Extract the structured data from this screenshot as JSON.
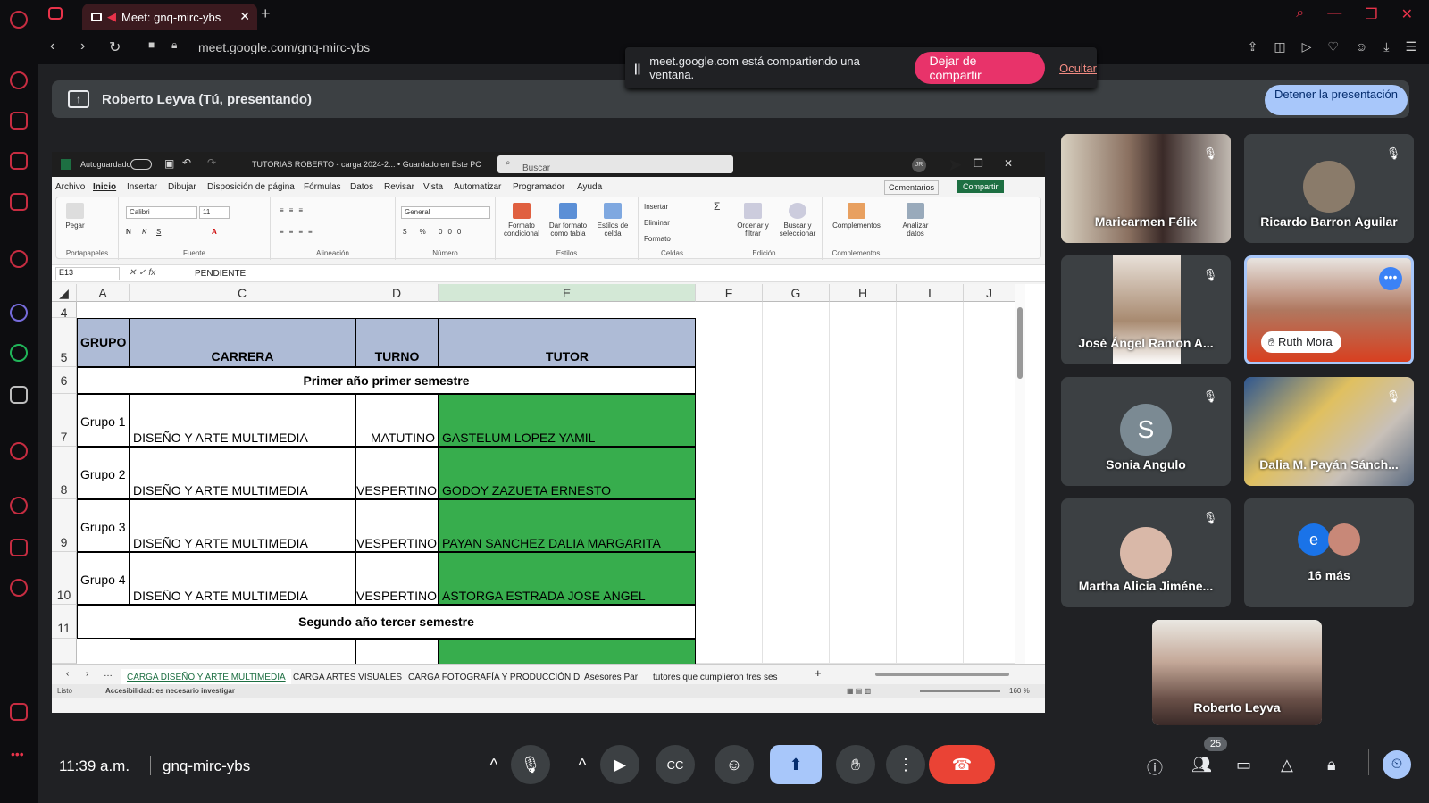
{
  "browser": {
    "tab_title": "Meet: gnq-mirc-ybs",
    "url": "meet.google.com/gnq-mirc-ybs",
    "share_notice": "meet.google.com está compartiendo una ventana.",
    "stop_sharing": "Dejar de compartir",
    "hide": "Ocultar"
  },
  "presentation": {
    "presenter_label": "Roberto Leyva (Tú, presentando)",
    "stop_presenting": "Detener la presentación"
  },
  "excel": {
    "autosave": "Autoguardado",
    "doc_title": "TUTORIAS ROBERTO - carga 2024-2... • Guardado en Este PC",
    "search": "Buscar",
    "user_initials": "JR",
    "menu": [
      "Archivo",
      "Inicio",
      "Insertar",
      "Dibujar",
      "Disposición de página",
      "Fórmulas",
      "Datos",
      "Revisar",
      "Vista",
      "Automatizar",
      "Programador",
      "Ayuda"
    ],
    "comments": "Comentarios",
    "share": "Compartir",
    "ribbon": {
      "clipboard": "Portapapeles",
      "paste": "Pegar",
      "font_group": "Fuente",
      "font": "Calibri",
      "size": "11",
      "align_group": "Alineación",
      "number_group": "Número",
      "number_format": "General",
      "cond_format": "Formato condicional",
      "table_format": "Dar formato como tabla",
      "cell_styles": "Estilos de celda",
      "styles_group": "Estilos",
      "insert": "Insertar",
      "delete": "Eliminar",
      "format": "Formato",
      "cells_group": "Celdas",
      "sort": "Ordenar y filtrar",
      "find": "Buscar y seleccionar",
      "edit_group": "Edición",
      "addins": "Complementos",
      "addins_group": "Complementos",
      "analyze": "Analizar datos"
    },
    "name_box": "E13",
    "formula": "PENDIENTE",
    "columns": [
      "A",
      "C",
      "D",
      "E",
      "F",
      "G",
      "H",
      "I",
      "J"
    ],
    "rows": [
      "4",
      "5",
      "6",
      "7",
      "8",
      "9",
      "10",
      "11"
    ],
    "headers": {
      "grupo": "GRUPO",
      "carrera": "CARRERA",
      "turno": "TURNO",
      "tutor": "TUTOR"
    },
    "section1": "Primer año primer semestre",
    "section2": "Segundo año tercer semestre",
    "data": [
      {
        "grupo": "Grupo 1",
        "carrera": "DISEÑO Y ARTE MULTIMEDIA",
        "turno": "MATUTINO",
        "tutor": "GASTELUM LOPEZ YAMIL"
      },
      {
        "grupo": "Grupo 2",
        "carrera": "DISEÑO Y ARTE MULTIMEDIA",
        "turno": "VESPERTINO",
        "tutor": "GODOY ZAZUETA ERNESTO"
      },
      {
        "grupo": "Grupo 3",
        "carrera": "DISEÑO Y ARTE MULTIMEDIA",
        "turno": "VESPERTINO",
        "tutor": "PAYAN SANCHEZ DALIA MARGARITA"
      },
      {
        "grupo": "Grupo 4",
        "carrera": "DISEÑO Y ARTE MULTIMEDIA",
        "turno": "VESPERTINO",
        "tutor": "ASTORGA ESTRADA JOSE ANGEL"
      }
    ],
    "sheet_tabs": [
      "CARGA DISEÑO Y ARTE MULTIMEDIA",
      "CARGA ARTES VISUALES",
      "CARGA FOTOGRAFÍA Y PRODUCCIÓN D",
      "Asesores Par",
      "tutores que cumplieron tres ses"
    ],
    "status_ready": "Listo",
    "accessibility": "Accesibilidad: es necesario investigar",
    "zoom": "160 %"
  },
  "participants": [
    {
      "name": "Maricarmen Félix",
      "muted": true
    },
    {
      "name": "Ricardo Barron Aguilar",
      "muted": true
    },
    {
      "name": "José Ángel Ramon A...",
      "muted": true
    },
    {
      "name": "Ruth Mora",
      "muted": false
    },
    {
      "name": "Sonia Angulo",
      "initial": "S",
      "muted": true
    },
    {
      "name": "Dalia M. Payán Sánch...",
      "muted": true
    },
    {
      "name": "Martha Alicia Jiméne...",
      "muted": true
    },
    {
      "name": "16 más",
      "initial": "e"
    },
    {
      "name": "Roberto Leyva"
    }
  ],
  "meeting": {
    "time": "11:39 a.m.",
    "code": "gnq-mirc-ybs",
    "participant_count": "25"
  },
  "colors": {
    "accent": "#a8c7fa",
    "hangup": "#ea4335",
    "stopshare": "#e8336a",
    "header_fill": "#aebbd6",
    "tutor_fill": "#37ad4d"
  }
}
